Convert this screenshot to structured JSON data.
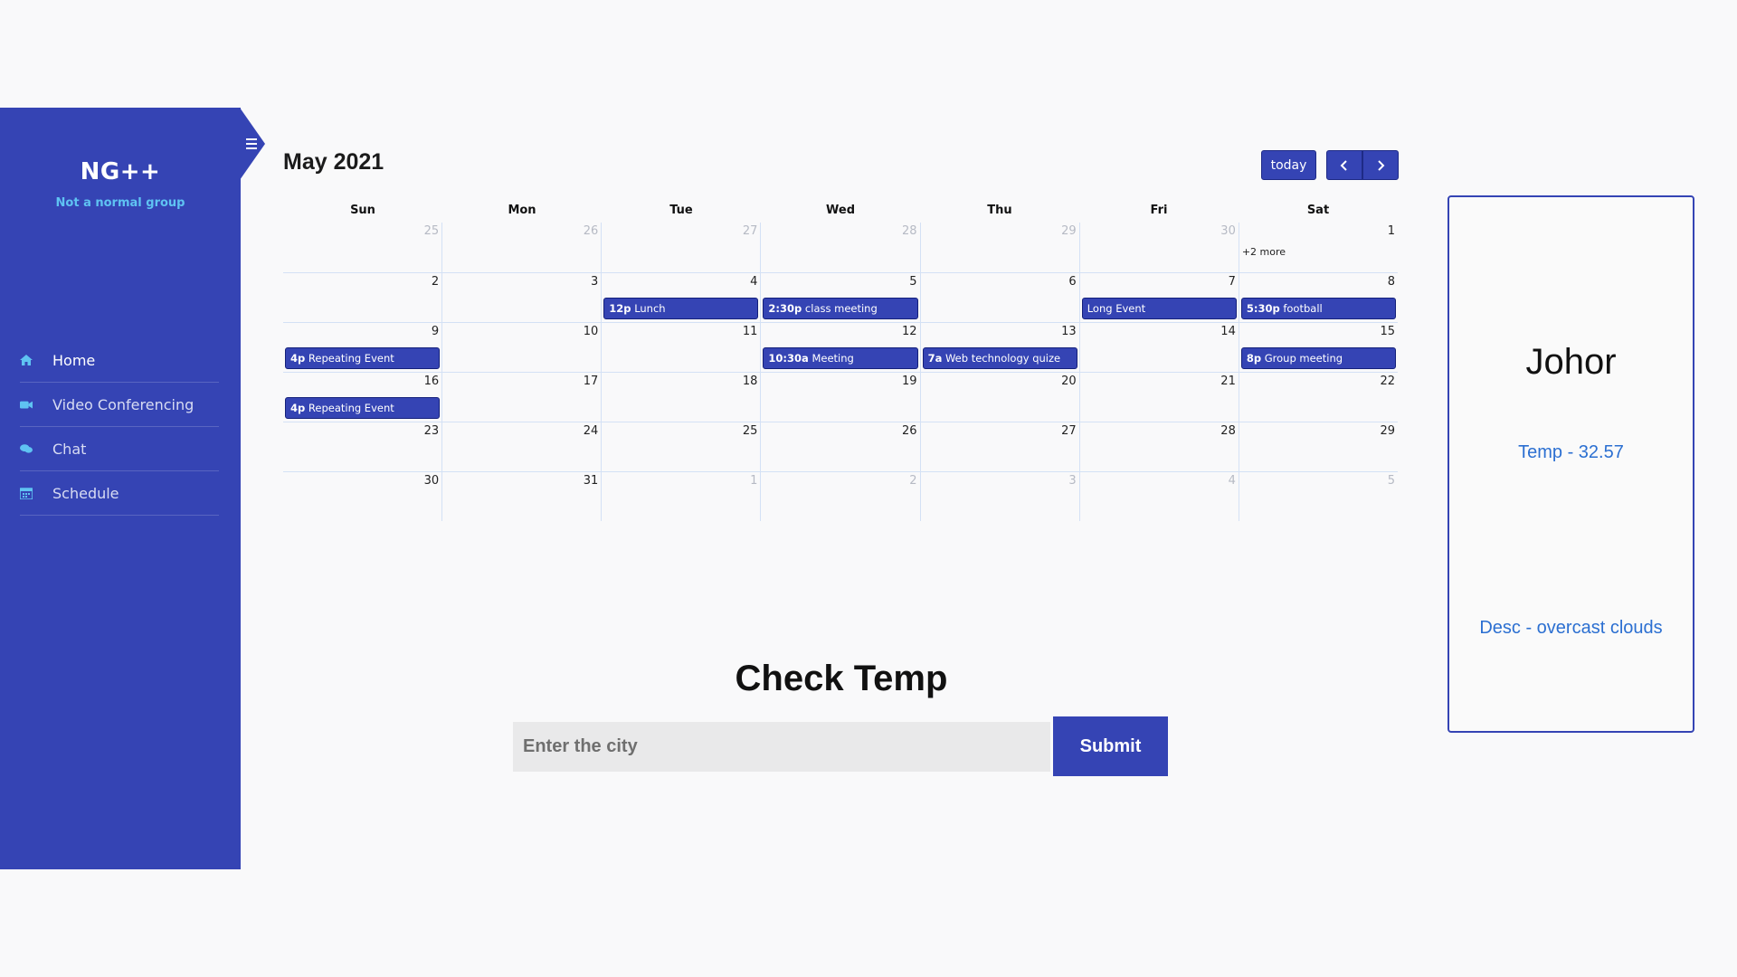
{
  "sidebar": {
    "brand_name": "NG++",
    "brand_tagline": "Not a normal group",
    "items": [
      {
        "label": "Home",
        "icon": "home-icon"
      },
      {
        "label": "Video Conferencing",
        "icon": "video-icon"
      },
      {
        "label": "Chat",
        "icon": "chat-icon"
      },
      {
        "label": "Schedule",
        "icon": "calendar-icon"
      }
    ]
  },
  "calendar": {
    "title": "May 2021",
    "today_label": "today",
    "days_of_week": [
      "Sun",
      "Mon",
      "Tue",
      "Wed",
      "Thu",
      "Fri",
      "Sat"
    ],
    "weeks": [
      [
        {
          "num": "25",
          "other": true
        },
        {
          "num": "26",
          "other": true
        },
        {
          "num": "27",
          "other": true
        },
        {
          "num": "28",
          "other": true
        },
        {
          "num": "29",
          "other": true
        },
        {
          "num": "30",
          "other": true
        },
        {
          "num": "1",
          "more": "+2 more"
        }
      ],
      [
        {
          "num": "2"
        },
        {
          "num": "3"
        },
        {
          "num": "4",
          "event": {
            "time": "12p",
            "title": "Lunch"
          }
        },
        {
          "num": "5",
          "event": {
            "time": "2:30p",
            "title": "class meeting"
          }
        },
        {
          "num": "6"
        },
        {
          "num": "7",
          "event": {
            "time": "",
            "title": "Long Event"
          }
        },
        {
          "num": "8",
          "event": {
            "time": "5:30p",
            "title": "football"
          }
        }
      ],
      [
        {
          "num": "9",
          "event": {
            "time": "4p",
            "title": "Repeating Event"
          }
        },
        {
          "num": "10"
        },
        {
          "num": "11"
        },
        {
          "num": "12",
          "event": {
            "time": "10:30a",
            "title": "Meeting"
          }
        },
        {
          "num": "13",
          "event": {
            "time": "7a",
            "title": "Web technology quize"
          }
        },
        {
          "num": "14"
        },
        {
          "num": "15",
          "event": {
            "time": "8p",
            "title": "Group meeting"
          }
        }
      ],
      [
        {
          "num": "16",
          "event": {
            "time": "4p",
            "title": "Repeating Event"
          }
        },
        {
          "num": "17"
        },
        {
          "num": "18"
        },
        {
          "num": "19"
        },
        {
          "num": "20"
        },
        {
          "num": "21"
        },
        {
          "num": "22"
        }
      ],
      [
        {
          "num": "23"
        },
        {
          "num": "24"
        },
        {
          "num": "25"
        },
        {
          "num": "26"
        },
        {
          "num": "27"
        },
        {
          "num": "28"
        },
        {
          "num": "29"
        }
      ],
      [
        {
          "num": "30"
        },
        {
          "num": "31"
        },
        {
          "num": "1",
          "other": true
        },
        {
          "num": "2",
          "other": true
        },
        {
          "num": "3",
          "other": true
        },
        {
          "num": "4",
          "other": true
        },
        {
          "num": "5",
          "other": true
        }
      ]
    ]
  },
  "check_temp": {
    "title": "Check Temp",
    "input_placeholder": "Enter the city",
    "input_value": "",
    "submit_label": "Submit"
  },
  "weather": {
    "city": "Johor",
    "temp": "Temp - 32.57",
    "desc": "Desc - overcast clouds"
  },
  "colors": {
    "primary": "#3544b4",
    "accent_text": "#2b6fd1",
    "tagline": "#5fc3f2"
  }
}
